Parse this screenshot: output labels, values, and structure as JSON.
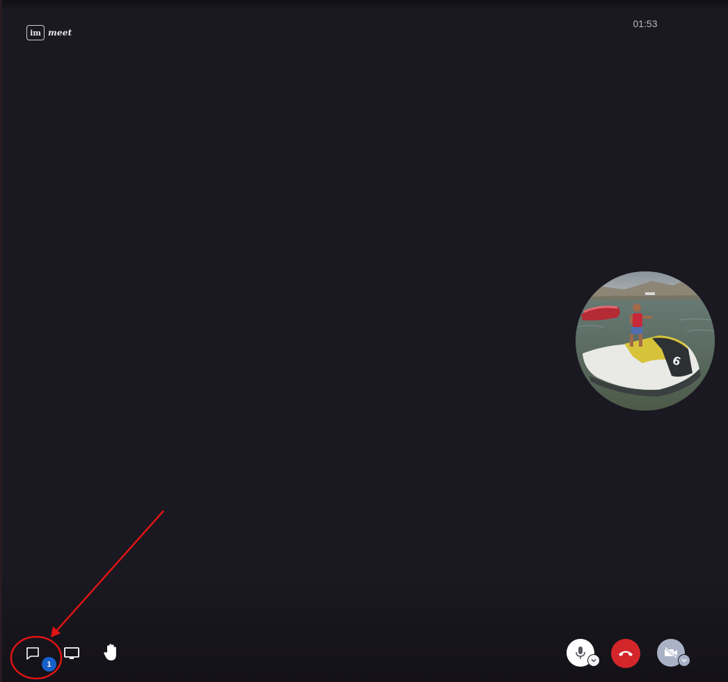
{
  "header": {
    "logo_prefix": "im",
    "logo_suffix": "meet",
    "call_timer": "01:53"
  },
  "participant": {
    "avatar_icon": "participant-avatar-photo"
  },
  "toolbar_left": {
    "chat_icon": "chat-bubble-icon",
    "unread_count": "1",
    "screen_share_icon": "monitor-icon",
    "raise_hand_icon": "hand-icon"
  },
  "toolbar_right": {
    "mic_icon": "microphone-icon",
    "hangup_icon": "phone-hangup-icon",
    "video_icon": "video-off-icon",
    "chevron_icon": "chevron-down-icon"
  },
  "colors": {
    "background": "#1a1820",
    "badge": "#1760c9",
    "hangup": "#d3262b",
    "video_off": "#a9b2c6",
    "annotation": "#e01414"
  }
}
